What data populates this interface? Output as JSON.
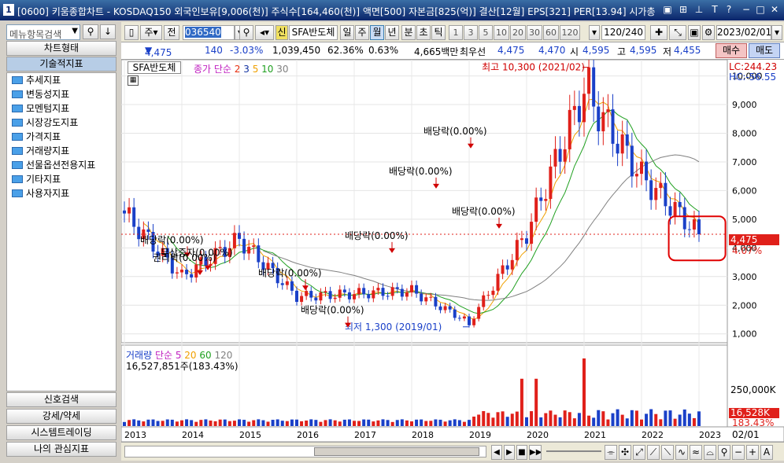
{
  "window": {
    "number": "1",
    "title": "[0600] 키움종합차트 - KOSDAQ150 외국인보유[9,006(천)] 주식수[164,460(천)] 액면[500] 자본금[825(억)] 결산[12월] EPS[321] PER[13.94] 시가총"
  },
  "left_panel": {
    "search_placeholder": "메뉴항목검색",
    "chart_type_label": "차트형태",
    "tech_label": "기술적지표",
    "tree_items": [
      "추세지표",
      "변동성지표",
      "모멘텀지표",
      "시장강도지표",
      "가격지표",
      "거래량지표",
      "선물옵션전용지표",
      "기타지표",
      "사용자지표"
    ],
    "bottom_buttons": [
      "신호검색",
      "강세/약세",
      "시스템트레이딩",
      "나의 관심지표"
    ]
  },
  "toolbar": {
    "period_select": "주",
    "prev_label": "전",
    "code": "036540",
    "new_label": "신",
    "stock_name": "SFA반도체",
    "periods": [
      "일",
      "주",
      "월",
      "년",
      "분",
      "초",
      "틱"
    ],
    "selected_period": "월",
    "intervals": [
      "1",
      "3",
      "5",
      "10",
      "20",
      "30",
      "60",
      "120"
    ],
    "count": "120",
    "count_total": "/240",
    "date": "2023/02/01"
  },
  "infobar": {
    "price": "4,475",
    "change": "140",
    "change_pct": "-3.03%",
    "volume": "1,039,450",
    "vol_ratio": "62.36%",
    "turnover": "0.63%",
    "amount": "4,665백만",
    "best_ask_label": "최우선",
    "best_ask": "4,475",
    "best_bid": "4,470",
    "open_label": "시",
    "open": "4,595",
    "high_label": "고",
    "high": "4,595",
    "low_label": "저",
    "low": "4,455",
    "buy_label": "매수",
    "sell_label": "매도"
  },
  "chart": {
    "stock_tag": "SFA반도체",
    "ma_legend_prefix": "종가 단순",
    "ma_legend": [
      {
        "label": "2",
        "color": "#e83010"
      },
      {
        "label": "3",
        "color": "#1030a0"
      },
      {
        "label": "5",
        "color": "#f0a000"
      },
      {
        "label": "10",
        "color": "#20a020"
      },
      {
        "label": "30",
        "color": "#808080"
      }
    ],
    "lc": "LC:244.23",
    "hc": "HC:-56.55",
    "current_price_tag": "4,475",
    "current_pct_tag": "4.07%",
    "high_annotation": "최고 10,300 (2021/02)",
    "low_annotation": "최저 1,300 (2019/01)",
    "dividend_labels": [
      "배당락(0.00%)",
      "무상증자(0.00%)",
      "권리락(0.00%)",
      "배당락(0.00%)",
      "배당락(0.00%)",
      "배당락(0.00%)",
      "배당락(0.00%)",
      "배당락(0.00%)",
      "배당락(0.00%)"
    ],
    "y_ticks": [
      "10,000",
      "9,000",
      "8,000",
      "7,000",
      "6,000",
      "5,000",
      "4,000",
      "3,000",
      "2,000",
      "1,000"
    ],
    "volume_legend_prefix": "거래량",
    "volume_legend_mas": [
      {
        "label": "단순 5",
        "color": "#c020c0"
      },
      {
        "label": "20",
        "color": "#f0a000"
      },
      {
        "label": "60",
        "color": "#20a020"
      },
      {
        "label": "120",
        "color": "#808080"
      }
    ],
    "volume_value": "16,527,851주(183.43%)",
    "volume_tick": "250,000K",
    "volume_tag": "16,528K",
    "volume_pct_tag": "183.43%",
    "x_ticks": [
      "2013",
      "2014",
      "2015",
      "2016",
      "2017",
      "2018",
      "2019",
      "2020",
      "2021",
      "2022",
      "2023"
    ],
    "x_axis_end": "02/01"
  },
  "chart_data": {
    "type": "candlestick",
    "x": [
      "2013",
      "2014",
      "2015",
      "2016",
      "2017",
      "2018",
      "2019",
      "2020",
      "2021",
      "2022",
      "2023"
    ],
    "close": [
      5200,
      3000,
      4300,
      2300,
      2400,
      2500,
      1400,
      4500,
      9500,
      6500,
      4475
    ],
    "ylim": [
      800,
      10400
    ],
    "annotations": [
      {
        "label": "최고 10,300 (2021/02)",
        "y": 10300
      },
      {
        "label": "최저 1,300 (2019/01)",
        "y": 1300
      }
    ],
    "current_price": 4475
  },
  "colors": {
    "up": "#e0201a",
    "down": "#1a40c8",
    "accent": "#d00000"
  }
}
